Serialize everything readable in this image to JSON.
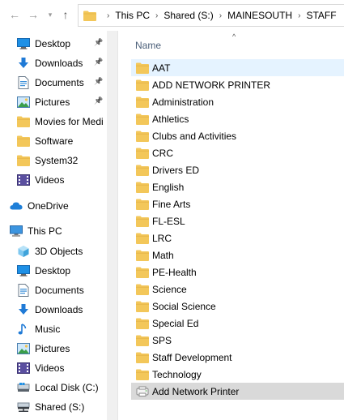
{
  "address": {
    "crumbs": [
      "This PC",
      "Shared (S:)",
      "MAINESOUTH",
      "STAFF"
    ]
  },
  "nav": {
    "quick_access": [
      {
        "label": "Desktop",
        "icon": "desktop-icon",
        "pinned": true
      },
      {
        "label": "Downloads",
        "icon": "downloads-icon",
        "pinned": true
      },
      {
        "label": "Documents",
        "icon": "documents-icon",
        "pinned": true
      },
      {
        "label": "Pictures",
        "icon": "pictures-icon",
        "pinned": true
      },
      {
        "label": "Movies for Medi",
        "icon": "folder-icon",
        "pinned": false
      },
      {
        "label": "Software",
        "icon": "folder-icon",
        "pinned": false
      },
      {
        "label": "System32",
        "icon": "folder-icon",
        "pinned": false
      },
      {
        "label": "Videos",
        "icon": "videos-icon",
        "pinned": false
      }
    ],
    "onedrive": {
      "label": "OneDrive",
      "icon": "cloud-icon"
    },
    "this_pc": {
      "label": "This PC",
      "icon": "computer-icon"
    },
    "this_pc_items": [
      {
        "label": "3D Objects",
        "icon": "3d-objects-icon"
      },
      {
        "label": "Desktop",
        "icon": "desktop-icon"
      },
      {
        "label": "Documents",
        "icon": "documents-icon"
      },
      {
        "label": "Downloads",
        "icon": "downloads-icon"
      },
      {
        "label": "Music",
        "icon": "music-icon"
      },
      {
        "label": "Pictures",
        "icon": "pictures-icon"
      },
      {
        "label": "Videos",
        "icon": "videos-icon"
      },
      {
        "label": "Local Disk (C:)",
        "icon": "drive-icon"
      },
      {
        "label": "Shared (S:)",
        "icon": "network-drive-icon"
      }
    ]
  },
  "content": {
    "column_name": "Name",
    "items": [
      {
        "label": "AAT",
        "icon": "folder-icon",
        "state": "hover"
      },
      {
        "label": "ADD NETWORK PRINTER",
        "icon": "folder-icon",
        "state": ""
      },
      {
        "label": "Administration",
        "icon": "folder-icon",
        "state": ""
      },
      {
        "label": "Athletics",
        "icon": "folder-icon",
        "state": ""
      },
      {
        "label": "Clubs and Activities",
        "icon": "folder-icon",
        "state": ""
      },
      {
        "label": "CRC",
        "icon": "folder-icon",
        "state": ""
      },
      {
        "label": "Drivers ED",
        "icon": "folder-icon",
        "state": ""
      },
      {
        "label": "English",
        "icon": "folder-icon",
        "state": ""
      },
      {
        "label": "Fine Arts",
        "icon": "folder-icon",
        "state": ""
      },
      {
        "label": "FL-ESL",
        "icon": "folder-icon",
        "state": ""
      },
      {
        "label": "LRC",
        "icon": "folder-icon",
        "state": ""
      },
      {
        "label": "Math",
        "icon": "folder-icon",
        "state": ""
      },
      {
        "label": "PE-Health",
        "icon": "folder-icon",
        "state": ""
      },
      {
        "label": "Science",
        "icon": "folder-icon",
        "state": ""
      },
      {
        "label": "Social Science",
        "icon": "folder-icon",
        "state": ""
      },
      {
        "label": "Special Ed",
        "icon": "folder-icon",
        "state": ""
      },
      {
        "label": "SPS",
        "icon": "folder-icon",
        "state": ""
      },
      {
        "label": "Staff Development",
        "icon": "folder-icon",
        "state": ""
      },
      {
        "label": "Technology",
        "icon": "folder-icon",
        "state": ""
      },
      {
        "label": "Add Network Printer",
        "icon": "shortcut-icon",
        "state": "selected"
      }
    ]
  },
  "colors": {
    "folder": "#f3c75a",
    "hover_row": "#e5f3ff",
    "selected_row": "#d9d9d9",
    "column_header_text": "#4c607a"
  }
}
